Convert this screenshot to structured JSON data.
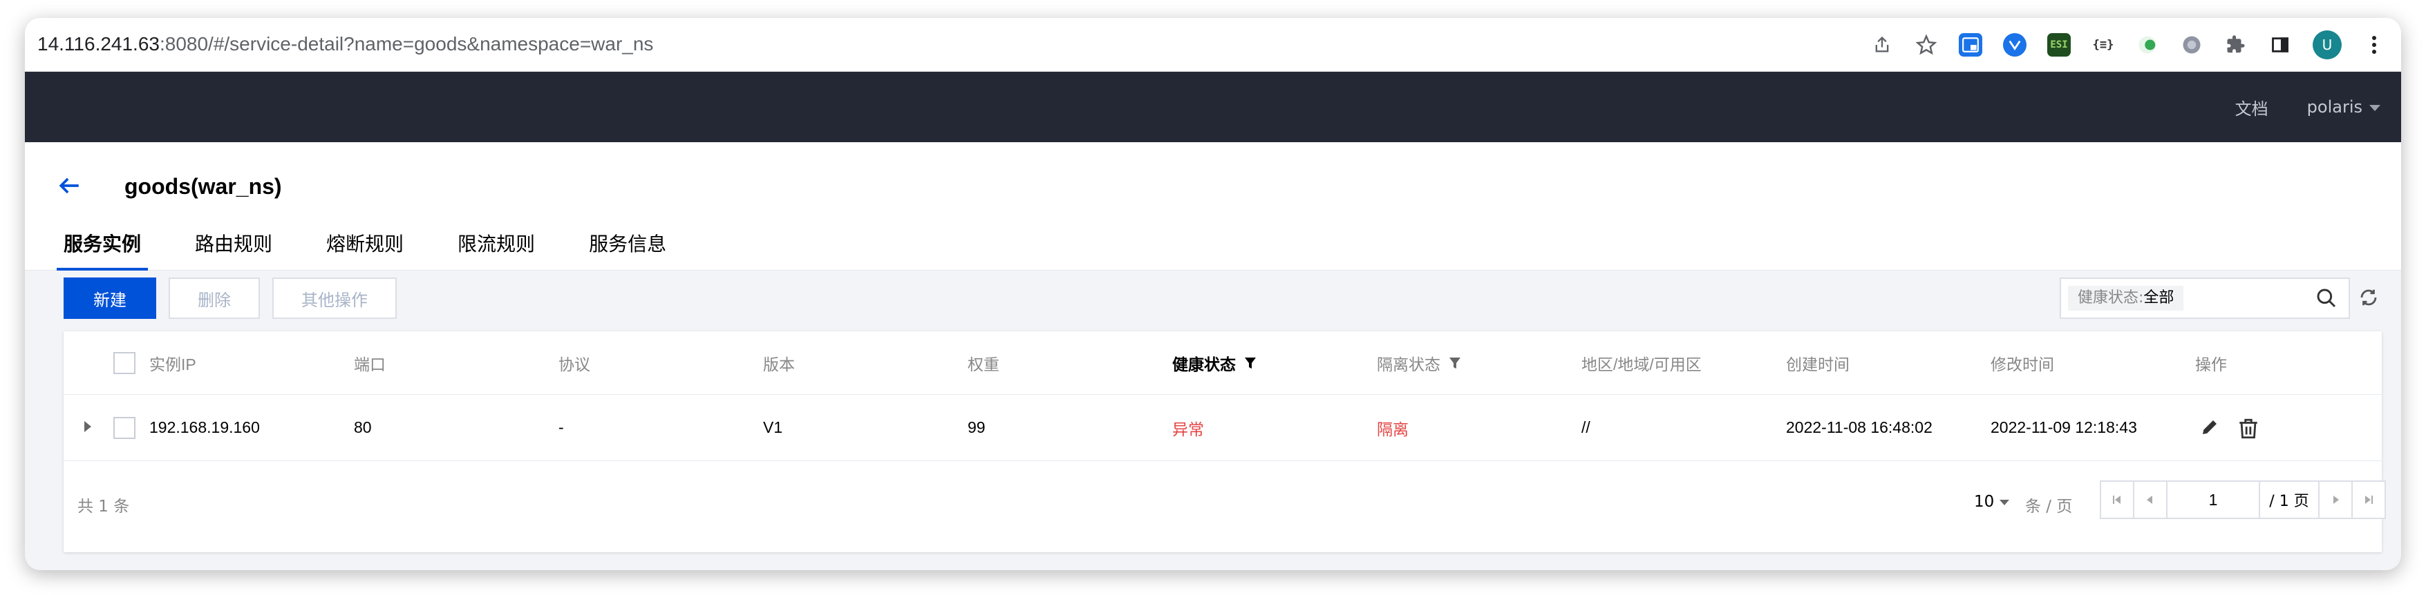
{
  "browser": {
    "url_host": "14.116.241.63",
    "url_rest": ":8080/#/service-detail?name=goods&namespace=war_ns",
    "icons": [
      "share-icon",
      "star-icon",
      "extension-icons",
      "puzzle-icon",
      "sidebar-icon",
      "menu-icon"
    ],
    "ext_labels": {
      "esi": "ESI",
      "json": "{≡}"
    },
    "avatar_initial": "U"
  },
  "nav": {
    "docs": "文档",
    "user": "polaris"
  },
  "page": {
    "title": "goods(war_ns)",
    "tabs": [
      {
        "label": "服务实例",
        "active": true
      },
      {
        "label": "路由规则",
        "active": false
      },
      {
        "label": "熔断规则",
        "active": false
      },
      {
        "label": "限流规则",
        "active": false
      },
      {
        "label": "服务信息",
        "active": false
      }
    ]
  },
  "toolbar": {
    "new": "新建",
    "delete": "删除",
    "more": "其他操作",
    "filter_key": "健康状态:",
    "filter_value": "全部"
  },
  "table": {
    "headers": [
      "实例IP",
      "端口",
      "协议",
      "版本",
      "权重",
      "健康状态",
      "隔离状态",
      "地区/地域/可用区",
      "创建时间",
      "修改时间",
      "操作"
    ],
    "rows": [
      {
        "ip": "192.168.19.160",
        "port": "80",
        "protocol": "-",
        "version": "V1",
        "weight": "99",
        "health": "异常",
        "isolate": "隔离",
        "region": "//",
        "created": "2022-11-08 16:48:02",
        "modified": "2022-11-09 12:18:43"
      }
    ]
  },
  "pagination": {
    "total": "共 1 条",
    "page_size": "10",
    "unit": "条 / 页",
    "current_page": "1",
    "of_pages": "/ 1 页"
  },
  "colors": {
    "primary": "#0052d9",
    "nav_bg": "#232834",
    "danger": "#e54545"
  }
}
